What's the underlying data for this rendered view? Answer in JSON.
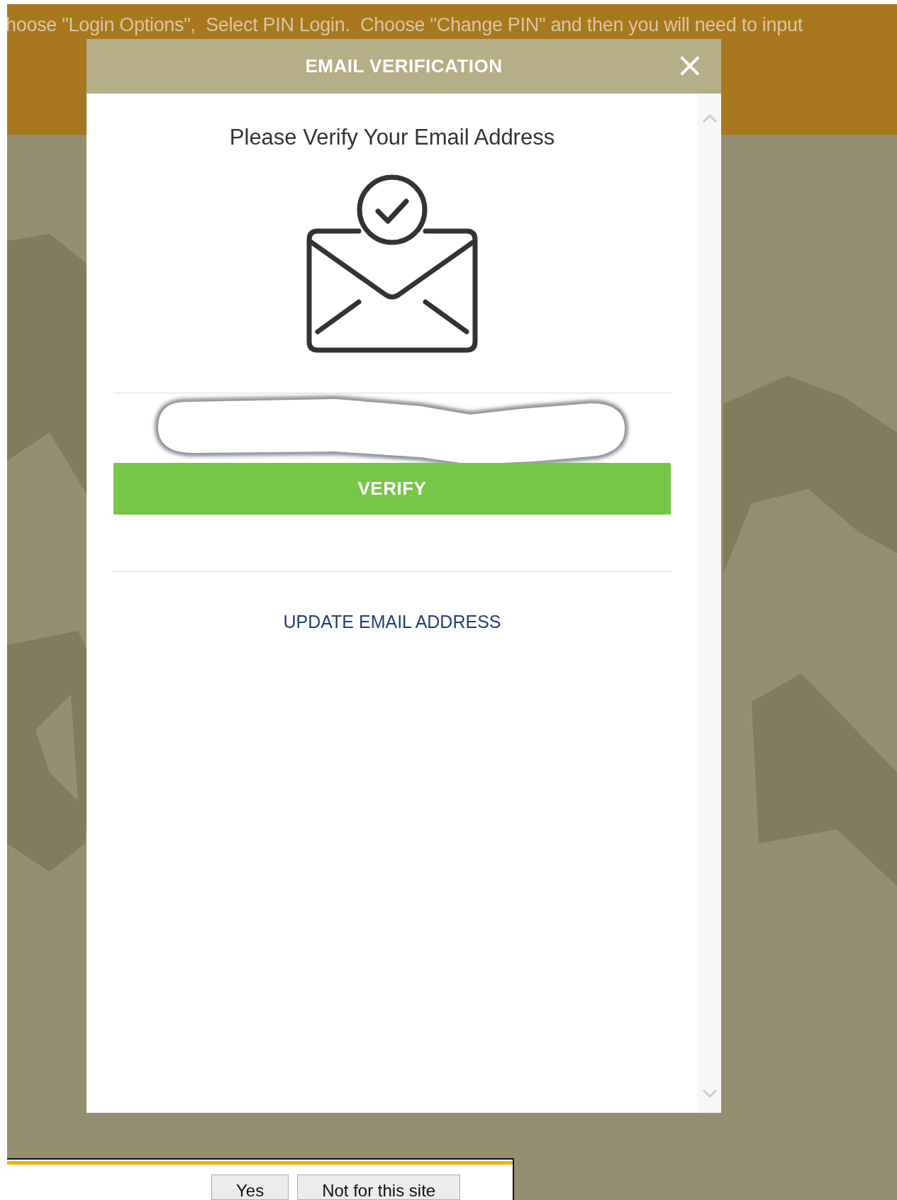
{
  "banner": {
    "text": "hoose \"Login Options\",  Select PIN Login.  Choose \"Change PIN\" and then you will need to input"
  },
  "dialog": {
    "title": "EMAIL VERIFICATION",
    "close": "×",
    "heading": "Please Verify Your Email Address",
    "verify_button": "VERIFY",
    "update_link": "UPDATE EMAIL ADDRESS"
  },
  "prompt_bar": {
    "buttons": [
      {
        "label": "Yes"
      },
      {
        "label": "Not for this site"
      }
    ]
  }
}
